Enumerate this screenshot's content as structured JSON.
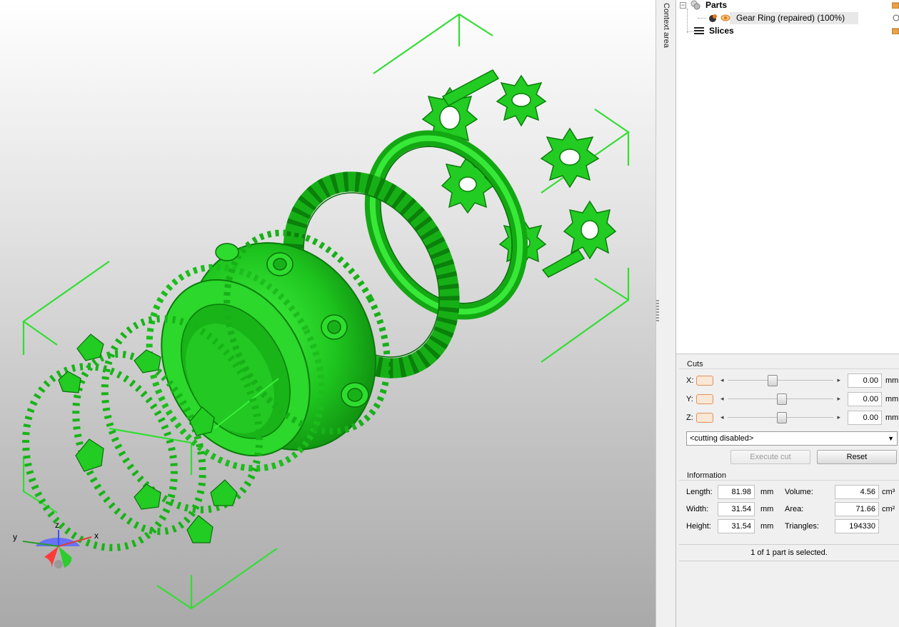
{
  "viewport": {
    "axis_gizmo": {
      "x": "x",
      "y": "y",
      "z": "z"
    },
    "model_color": "#22cc22",
    "bounding_box_color": "#33dd33"
  },
  "context_strip": {
    "label": "Context area"
  },
  "tree": {
    "parts": {
      "label": "Parts",
      "icon": "parts-spheres-icon",
      "expander": "−"
    },
    "part": {
      "label": "Gear Ring (repaired) (100%)",
      "icon": "part-mesh-icon",
      "visibility_icon": "eye-icon"
    },
    "slices": {
      "label": "Slices",
      "icon": "slices-stack-icon"
    }
  },
  "cuts": {
    "title": "Cuts",
    "axes": [
      {
        "label": "X:",
        "value": "0.00",
        "unit": "mm",
        "slider_position": 0.44
      },
      {
        "label": "Y:",
        "value": "0.00",
        "unit": "mm",
        "slider_position": 0.52
      },
      {
        "label": "Z:",
        "value": "0.00",
        "unit": "mm",
        "slider_position": 0.52
      }
    ],
    "mode_select": "<cutting disabled>",
    "execute_label": "Execute cut",
    "reset_label": "Reset"
  },
  "information": {
    "title": "Information",
    "length_label": "Length:",
    "length_value": "81.98",
    "length_unit": "mm",
    "width_label": "Width:",
    "width_value": "31.54",
    "width_unit": "mm",
    "height_label": "Height:",
    "height_value": "31.54",
    "height_unit": "mm",
    "volume_label": "Volume:",
    "volume_value": "4.56",
    "volume_unit": "cm³",
    "area_label": "Area:",
    "area_value": "71.66",
    "area_unit": "cm²",
    "triangles_label": "Triangles:",
    "triangles_value": "194330"
  },
  "status": {
    "selection_text": "1 of 1 part is selected."
  }
}
